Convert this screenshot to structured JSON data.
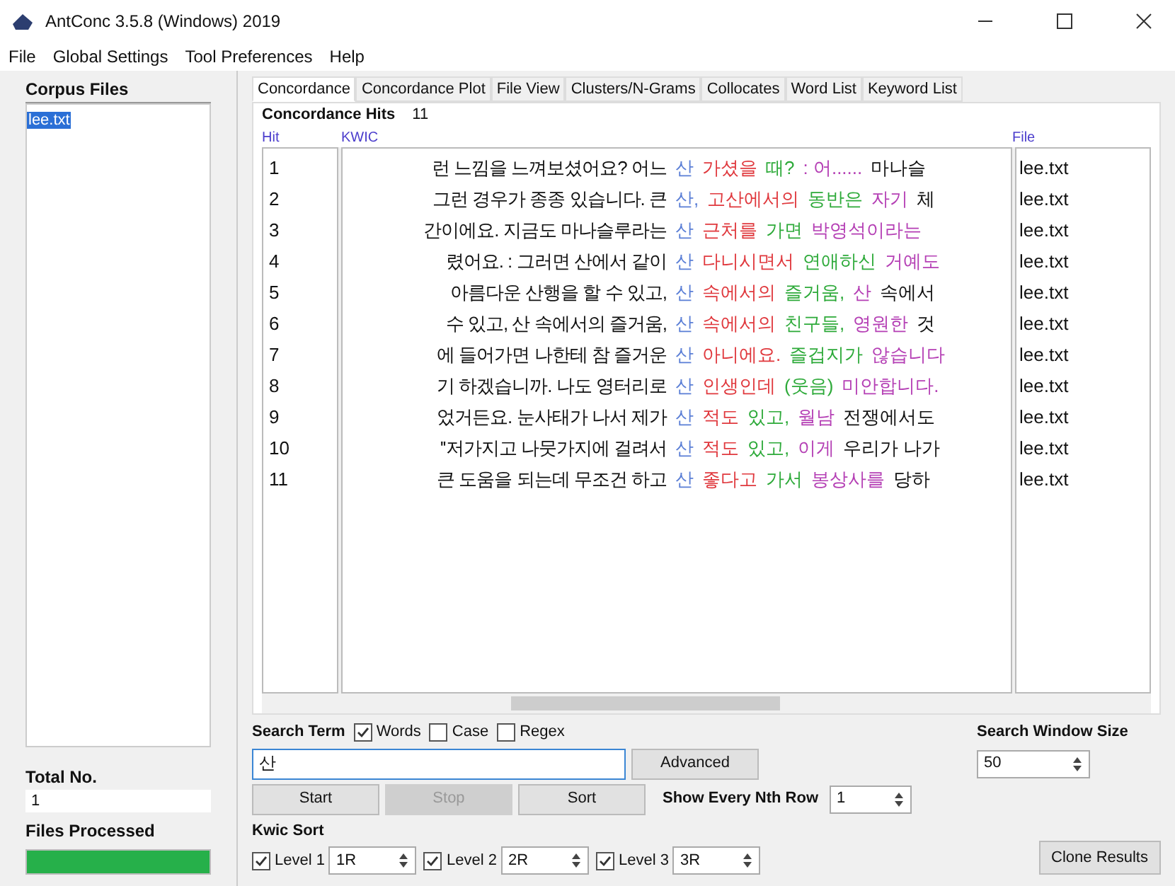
{
  "window": {
    "title": "AntConc 3.5.8 (Windows) 2019"
  },
  "menu": [
    "File",
    "Global Settings",
    "Tool Preferences",
    "Help"
  ],
  "sidebar": {
    "title": "Corpus Files",
    "files": [
      {
        "name": "lee.txt",
        "selected": true
      }
    ],
    "total_label": "Total No.",
    "total_value": "1",
    "processed_label": "Files Processed",
    "progress": {
      "level": 1
    }
  },
  "tabs": [
    {
      "label": "Concordance",
      "selected": true
    },
    {
      "label": "Concordance Plot",
      "selected": false
    },
    {
      "label": "File View",
      "selected": false
    },
    {
      "label": "Clusters/N-Grams",
      "selected": false
    },
    {
      "label": "Collocates",
      "selected": false
    },
    {
      "label": "Word List",
      "selected": false
    },
    {
      "label": "Keyword List",
      "selected": false
    }
  ],
  "hits": {
    "label": "Concordance Hits",
    "count": "11"
  },
  "table": {
    "columns": [
      "Hit",
      "KWIC",
      "File"
    ],
    "rows": [
      {
        "hit": "1",
        "left": "런 느낌을 느껴보셨어요? 어느",
        "key": "산",
        "words": [
          "가셨을",
          "때?",
          ": 어......"
        ],
        "rest": "마나슬",
        "file": "lee.txt"
      },
      {
        "hit": "2",
        "left": "그런 경우가 종종 있습니다. 큰",
        "key": "산,",
        "words": [
          "고산에서의",
          "동반은",
          "자기"
        ],
        "rest": "체",
        "file": "lee.txt"
      },
      {
        "hit": "3",
        "left": "간이에요. 지금도 마나슬루라는",
        "key": "산",
        "words": [
          "근처를",
          "가면",
          "박영석이라는"
        ],
        "file": "lee.txt"
      },
      {
        "hit": "4",
        "left": "렸어요.   : 그러면 산에서 같이",
        "key": "산",
        "words": [
          "다니시면서",
          "연애하신",
          "거예도"
        ],
        "file": "lee.txt"
      },
      {
        "hit": "5",
        "left": "아름다운 산행을 할 수 있고,",
        "key": "산",
        "words": [
          "속에서의",
          "즐거움,",
          "산"
        ],
        "rest": "속에서",
        "file": "lee.txt"
      },
      {
        "hit": "6",
        "left": "수 있고, 산 속에서의 즐거움,",
        "key": "산",
        "words": [
          "속에서의",
          "친구들,",
          "영원한"
        ],
        "rest": "것",
        "file": "lee.txt"
      },
      {
        "hit": "7",
        "left": "에 들어가면 나한테 참 즐거운",
        "key": "산",
        "words": [
          "아니에요.",
          "즐겁지가",
          "않습니다"
        ],
        "file": "lee.txt"
      },
      {
        "hit": "8",
        "left": "기 하겠습니까. 나도 영터리로",
        "key": "산",
        "words": [
          "인생인데",
          "(웃음)",
          "미안합니다."
        ],
        "file": "lee.txt"
      },
      {
        "hit": "9",
        "left": "었거든요. 눈사태가 나서 제가",
        "key": "산",
        "words": [
          "적도",
          "있고,",
          "월남"
        ],
        "rest": "전쟁에서도",
        "file": "lee.txt"
      },
      {
        "hit": "10",
        "left": "''저가지고 나뭇가지에 걸려서",
        "key": "산",
        "words": [
          "적도",
          "있고,",
          "이게"
        ],
        "rest": "우리가 나가",
        "file": "lee.txt"
      },
      {
        "hit": "11",
        "left": "큰 도움을 되는데 무조건 하고",
        "key": "산",
        "words": [
          "좋다고",
          "가서",
          "봉상사를"
        ],
        "rest": "당하",
        "file": "lee.txt"
      }
    ]
  },
  "search": {
    "label": "Search Term",
    "options": [
      {
        "label": "Words",
        "checked": true
      },
      {
        "label": "Case",
        "checked": false
      },
      {
        "label": "Regex",
        "checked": false
      }
    ],
    "value": "산",
    "advanced": "Advanced"
  },
  "window_size": {
    "label": "Search Window Size",
    "value": "50"
  },
  "buttons": [
    {
      "label": "Start",
      "disabled": false
    },
    {
      "label": "Stop",
      "disabled": true
    },
    {
      "label": "Sort",
      "disabled": false
    }
  ],
  "nth_row": {
    "label": "Show Every Nth Row",
    "value": "1"
  },
  "kwic_sort": {
    "label": "Kwic Sort",
    "levels": [
      {
        "label": "Level 1",
        "checked": true,
        "value": "1R"
      },
      {
        "label": "Level 2",
        "checked": true,
        "value": "2R"
      },
      {
        "label": "Level 3",
        "checked": true,
        "value": "3R"
      }
    ]
  },
  "clone": "Clone Results"
}
